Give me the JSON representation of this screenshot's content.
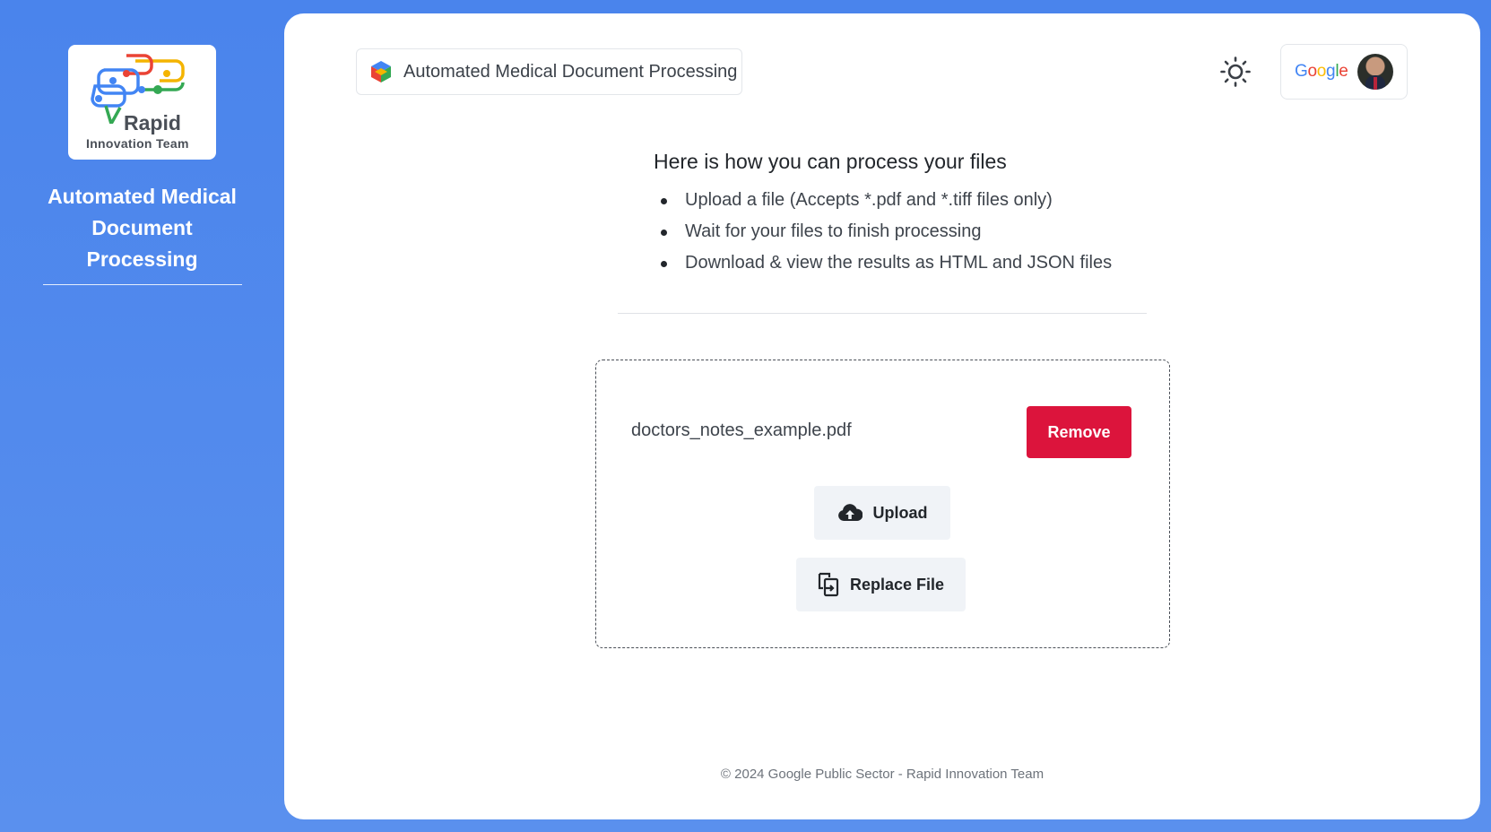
{
  "sidebar": {
    "logo": {
      "word": "Rapid",
      "subtitle": "Innovation Team"
    },
    "title": "Automated Medical Document Processing"
  },
  "header": {
    "app_label": "Automated Medical Document Processing",
    "theme_icon": "sun-icon",
    "account": {
      "brand": "Google",
      "avatar": "user-avatar"
    }
  },
  "instructions": {
    "title": "Here is how you can process your files",
    "steps": [
      "Upload a file (Accepts *.pdf and *.tiff files only)",
      "Wait for your files to finish processing",
      "Download & view the results as HTML and JSON files"
    ]
  },
  "dropzone": {
    "file_name": "doctors_notes_example.pdf",
    "remove_label": "Remove",
    "upload_label": "Upload",
    "replace_label": "Replace File"
  },
  "footer": {
    "text": "© 2024 Google Public Sector - Rapid Innovation Team"
  },
  "colors": {
    "background": "#4a84ec",
    "remove": "#dc143c",
    "soft_button": "#f0f3f7"
  }
}
